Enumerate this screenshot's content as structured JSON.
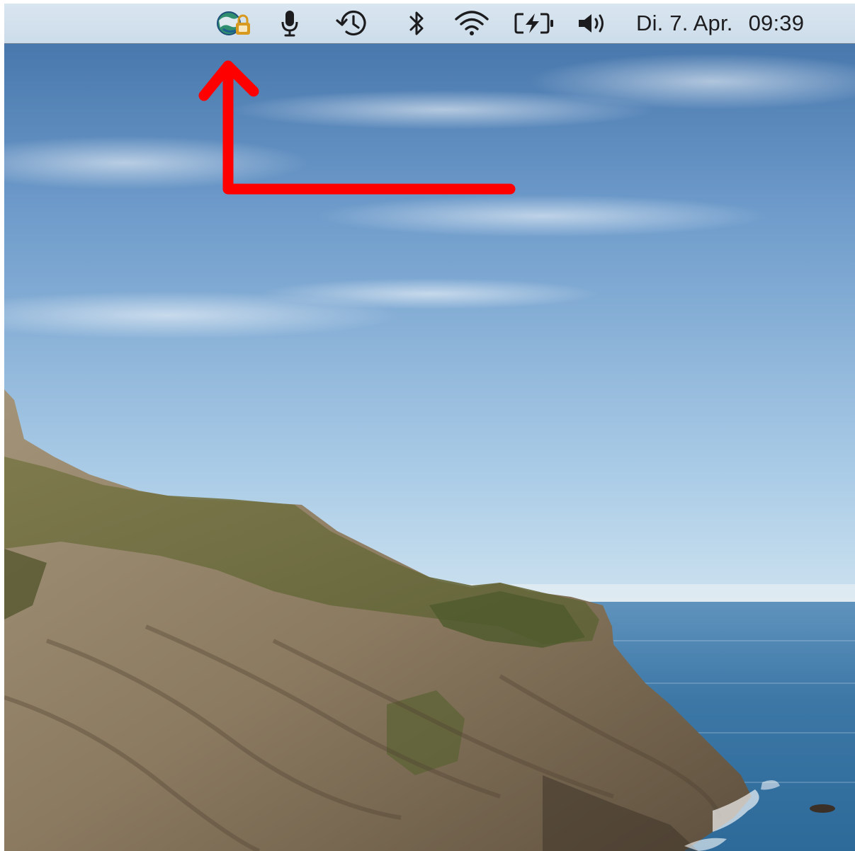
{
  "menubar": {
    "status_icons": [
      {
        "name": "vpn-globe-lock-icon",
        "glyph": "globe with padlock"
      },
      {
        "name": "microphone-icon",
        "glyph": "microphone"
      },
      {
        "name": "time-machine-icon",
        "glyph": "clock arrow"
      },
      {
        "name": "bluetooth-icon",
        "glyph": "bluetooth"
      },
      {
        "name": "wifi-icon",
        "glyph": "wifi"
      },
      {
        "name": "battery-charging-icon",
        "glyph": "battery with bolt"
      },
      {
        "name": "volume-icon",
        "glyph": "speaker"
      }
    ],
    "clock": {
      "date": "Di. 7. Apr.",
      "time": "09:39"
    }
  },
  "annotation": {
    "color": "#ff0000",
    "shape": "arrow pointing up at vpn-globe-lock-icon"
  },
  "colors": {
    "menubar_bg": "#d3e1ec",
    "sky_top": "#4f7eb0",
    "sky_bottom": "#bfd8ea",
    "sea": "#2f6f9f",
    "cliff": "#8f7f66",
    "icon": "#1c1c1e",
    "lock_badge": "#d89a1e"
  }
}
